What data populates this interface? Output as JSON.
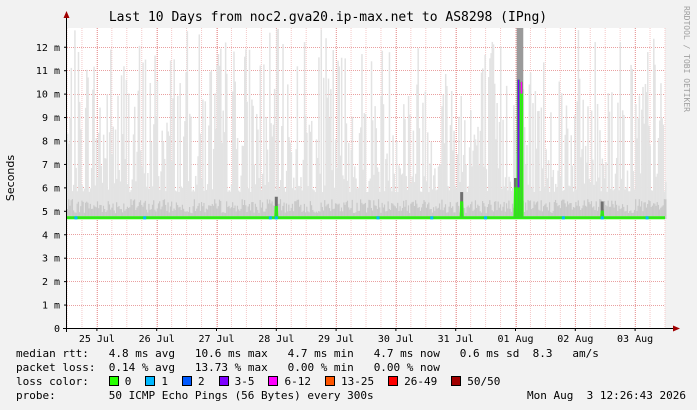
{
  "chart_data": {
    "type": "area",
    "title": "Last 10 Days from noc2.gva20.ip-max.net to AS8298 (IPng)",
    "ylabel": "Seconds",
    "xlabel": "",
    "ylim": [
      0,
      0.0128
    ],
    "y_ticks": [
      {
        "value": 0,
        "label": "0"
      },
      {
        "value": 0.001,
        "label": "1 m"
      },
      {
        "value": 0.002,
        "label": "2 m"
      },
      {
        "value": 0.003,
        "label": "3 m"
      },
      {
        "value": 0.004,
        "label": "4 m"
      },
      {
        "value": 0.005,
        "label": "5 m"
      },
      {
        "value": 0.006,
        "label": "6 m"
      },
      {
        "value": 0.007,
        "label": "7 m"
      },
      {
        "value": 0.008,
        "label": "8 m"
      },
      {
        "value": 0.009,
        "label": "9 m"
      },
      {
        "value": 0.01,
        "label": "10 m"
      },
      {
        "value": 0.011,
        "label": "11 m"
      },
      {
        "value": 0.012,
        "label": "12 m"
      }
    ],
    "x_ticks": [
      "25 Jul",
      "26 Jul",
      "27 Jul",
      "28 Jul",
      "29 Jul",
      "30 Jul",
      "31 Jul",
      "01 Aug",
      "02 Aug",
      "03 Aug"
    ],
    "x_range_days": [
      0,
      10
    ],
    "x_tick_positions_days": [
      0.5,
      1.5,
      2.5,
      3.5,
      4.5,
      5.5,
      6.5,
      7.5,
      8.5,
      9.5
    ],
    "grid": true,
    "median_rtt_series": {
      "baseline": 0.0047,
      "events": [
        {
          "day": 3.5,
          "value": 0.0052
        },
        {
          "day": 6.6,
          "value": 0.0054
        },
        {
          "day": 7.5,
          "value": 0.006
        },
        {
          "day": 7.55,
          "value": 0.0106
        },
        {
          "day": 7.6,
          "value": 0.0105
        },
        {
          "day": 8.95,
          "value": 0.005
        }
      ]
    },
    "spike_extent_max": 0.0128
  },
  "side_text": "RRDTOOL / TOBI OETIKER",
  "stats": {
    "median_rtt": {
      "label": "median rtt:",
      "avg": "4.8 ms avg",
      "max": "10.6 ms max",
      "min": "4.7 ms min",
      "now": "4.7 ms now",
      "sd": "0.6 ms sd",
      "am": "8.3   am/s"
    },
    "packet_loss": {
      "label": "packet loss:",
      "avg": "0.14 % avg",
      "max": "13.73 % max",
      "min": "0.00 % min",
      "now": "0.00 % now"
    },
    "loss_color": {
      "label": "loss color:",
      "items": [
        {
          "label": "0",
          "color": "#26ff00"
        },
        {
          "label": "1",
          "color": "#00b8ff"
        },
        {
          "label": "2",
          "color": "#0059ff"
        },
        {
          "label": "3-5",
          "color": "#7e00ff"
        },
        {
          "label": "6-12",
          "color": "#ff00ff"
        },
        {
          "label": "13-25",
          "color": "#ff5500"
        },
        {
          "label": "26-49",
          "color": "#ff0000"
        },
        {
          "label": "50/50",
          "color": "#a10000"
        }
      ]
    },
    "probe": {
      "label": "probe:",
      "text": "50 ICMP Echo Pings (56 Bytes) every 300s",
      "timestamp": "Mon Aug  3 12:26:43 2026"
    }
  }
}
